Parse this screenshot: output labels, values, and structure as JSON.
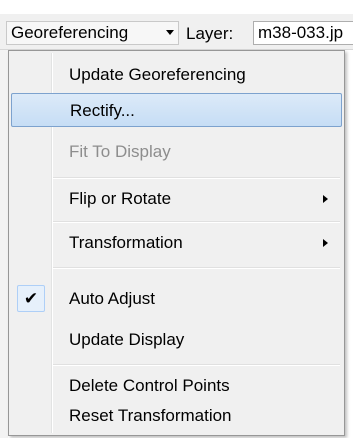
{
  "toolbar": {
    "georef_label": "Georeferencing",
    "layer_label": "Layer:",
    "layer_value": "m38-033.jp"
  },
  "menu": {
    "items": [
      {
        "label": "Update Georeferencing"
      },
      {
        "label": "Rectify..."
      },
      {
        "label": "Fit To Display"
      },
      {
        "label": "Flip or Rotate"
      },
      {
        "label": "Transformation"
      },
      {
        "label": "Auto Adjust",
        "check": "✔"
      },
      {
        "label": "Update Display"
      },
      {
        "label": "Delete Control Points"
      },
      {
        "label": "Reset Transformation"
      }
    ]
  },
  "colors": {
    "highlight": "#c6ddf5",
    "highlight_border": "#7da2ce",
    "disabled_text": "#8d8d8d"
  }
}
